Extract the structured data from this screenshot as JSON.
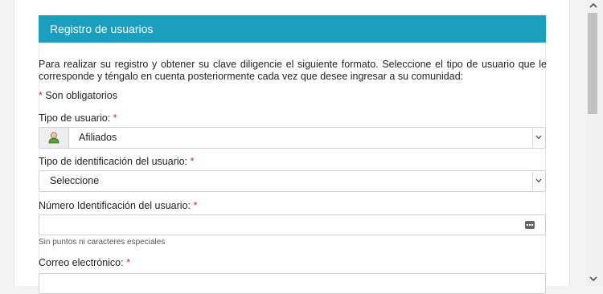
{
  "panel": {
    "title": "Registro de usuarios"
  },
  "intro": "Para realizar su registro y obtener su clave diligencie el siguiente formato. Seleccione el tipo de usuario que le corresponde y téngalo en cuenta posteriormente cada vez que desee ingresar a su comunidad:",
  "required_note": {
    "star": "*",
    "text": "Son obligatorios"
  },
  "fields": {
    "user_type": {
      "label": "Tipo de usuario:",
      "star": "*",
      "value": "Afiliados",
      "icon": "user-icon"
    },
    "id_type": {
      "label": "Tipo de identificación del usuario:",
      "star": "*",
      "value": "Seleccione"
    },
    "id_number": {
      "label": "Número Identificación del usuario:",
      "star": "*",
      "value": "",
      "hint": "Sin puntos ni caracteres especiales",
      "icon": "keyboard-icon"
    },
    "email": {
      "label": "Correo electrónico:",
      "star": "*",
      "value": ""
    }
  },
  "colors": {
    "header": "#1b9fbe",
    "required": "#d9262c"
  }
}
